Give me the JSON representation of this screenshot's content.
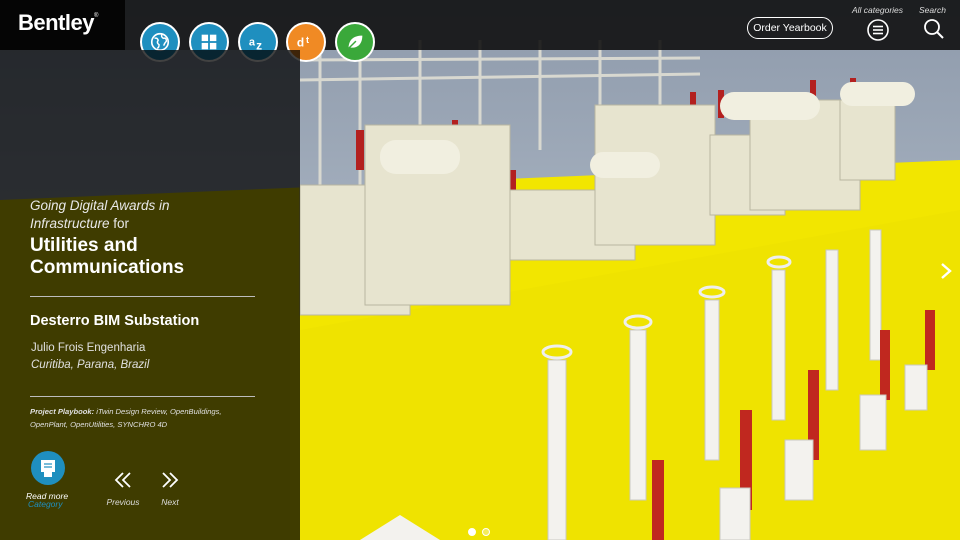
{
  "brand": {
    "logo_text": "Bentley",
    "logo_mark": "®"
  },
  "categories": [
    {
      "icon": "globe-icon",
      "color": "#1f8fbf"
    },
    {
      "icon": "grid-icon",
      "color": "#1f8fbf"
    },
    {
      "icon": "az-icon",
      "color": "#1f8fbf"
    },
    {
      "icon": "dt-icon",
      "color": "#f08a24"
    },
    {
      "icon": "leaf-icon",
      "color": "#3aa83a"
    }
  ],
  "header": {
    "order_label": "Order Yearbook",
    "all_categories_label": "All categories",
    "search_label": "Search"
  },
  "panel": {
    "award_line1": "Going Digital Awards in",
    "award_line2_italic": "Infrastructure",
    "award_line2_rest": " for",
    "category_title": "Utilities and Communications",
    "project_title": "Desterro BIM Substation",
    "organization": "Julio Frois Engenharia",
    "location": "Curitiba, Parana, Brazil",
    "playbook_label": "Project Playbook:",
    "playbook_text": " iTwin Design Review, OpenBuildings, OpenPlant, OpenUtilities, SYNCHRO 4D",
    "read_more_label": "Read more",
    "category_label": "Category",
    "previous_label": "Previous",
    "next_label": "Next"
  },
  "slides": {
    "count": 2,
    "active": 1
  },
  "colors": {
    "accent_blue": "#1f8fbf",
    "ground_yellow": "#f2e600",
    "sky": "#a9b8c7"
  }
}
